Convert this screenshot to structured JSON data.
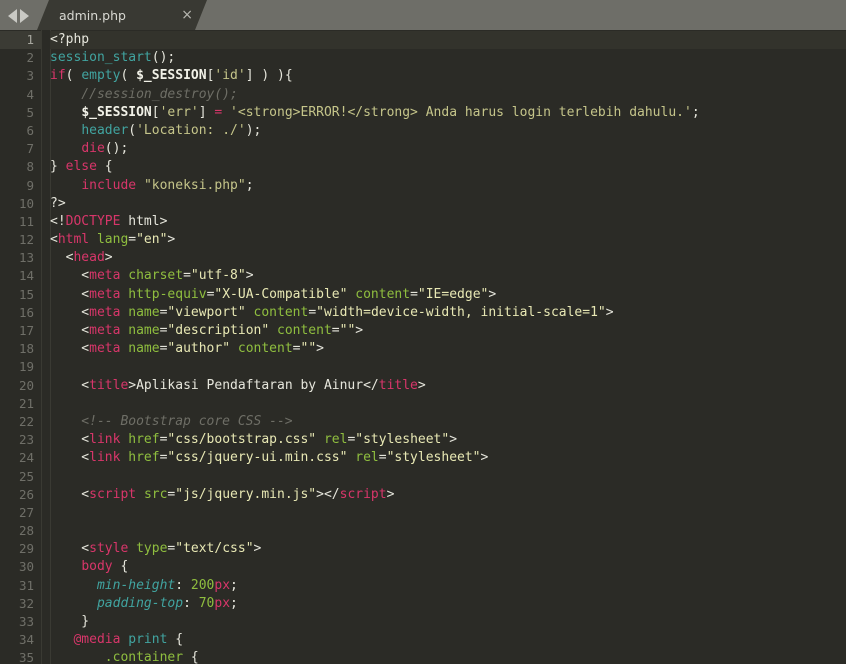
{
  "window": {
    "tab_bar": {
      "nav_prev_icon": "arrow-left-icon",
      "nav_next_icon": "arrow-right-icon",
      "tabs": [
        {
          "title": "admin.php",
          "close_label": "×",
          "active": true
        }
      ]
    }
  },
  "editor": {
    "language": "php",
    "current_line": 1,
    "first_line_number": 1,
    "line_count": 35,
    "lines": [
      {
        "n": 1,
        "tokens": [
          {
            "t": "<?php",
            "c": "t-plain"
          }
        ]
      },
      {
        "n": 2,
        "tokens": [
          {
            "t": "session_start",
            "c": "t-fn"
          },
          {
            "t": "();",
            "c": "t-punc"
          }
        ]
      },
      {
        "n": 3,
        "tokens": [
          {
            "t": "if",
            "c": "t-kw"
          },
          {
            "t": "( ",
            "c": "t-punc"
          },
          {
            "t": "empty",
            "c": "t-fn"
          },
          {
            "t": "( ",
            "c": "t-punc"
          },
          {
            "t": "$_SESSION",
            "c": "t-var"
          },
          {
            "t": "[",
            "c": "t-punc"
          },
          {
            "t": "'id'",
            "c": "t-str"
          },
          {
            "t": "] ) ){",
            "c": "t-punc"
          }
        ]
      },
      {
        "n": 4,
        "tokens": [
          {
            "t": "    //session_destroy();",
            "c": "t-com"
          }
        ]
      },
      {
        "n": 5,
        "tokens": [
          {
            "t": "    ",
            "c": "t-plain"
          },
          {
            "t": "$_SESSION",
            "c": "t-var"
          },
          {
            "t": "[",
            "c": "t-punc"
          },
          {
            "t": "'err'",
            "c": "t-str"
          },
          {
            "t": "] ",
            "c": "t-punc"
          },
          {
            "t": "=",
            "c": "t-op"
          },
          {
            "t": " ",
            "c": "t-plain"
          },
          {
            "t": "'<strong>ERROR!</strong> Anda harus login terlebih dahulu.'",
            "c": "t-str"
          },
          {
            "t": ";",
            "c": "t-punc"
          }
        ]
      },
      {
        "n": 6,
        "tokens": [
          {
            "t": "    ",
            "c": "t-plain"
          },
          {
            "t": "header",
            "c": "t-fn"
          },
          {
            "t": "(",
            "c": "t-punc"
          },
          {
            "t": "'Location: ./'",
            "c": "t-str"
          },
          {
            "t": ");",
            "c": "t-punc"
          }
        ]
      },
      {
        "n": 7,
        "tokens": [
          {
            "t": "    ",
            "c": "t-plain"
          },
          {
            "t": "die",
            "c": "t-kw"
          },
          {
            "t": "();",
            "c": "t-punc"
          }
        ]
      },
      {
        "n": 8,
        "tokens": [
          {
            "t": "} ",
            "c": "t-punc"
          },
          {
            "t": "else",
            "c": "t-kw"
          },
          {
            "t": " {",
            "c": "t-punc"
          }
        ]
      },
      {
        "n": 9,
        "tokens": [
          {
            "t": "    ",
            "c": "t-plain"
          },
          {
            "t": "include",
            "c": "t-kw"
          },
          {
            "t": " ",
            "c": "t-plain"
          },
          {
            "t": "\"koneksi.php\"",
            "c": "t-str"
          },
          {
            "t": ";",
            "c": "t-punc"
          }
        ]
      },
      {
        "n": 10,
        "tokens": [
          {
            "t": "?>",
            "c": "t-plain"
          }
        ]
      },
      {
        "n": 11,
        "tokens": [
          {
            "t": "<!",
            "c": "t-plain"
          },
          {
            "t": "DOCTYPE",
            "c": "t-doctype"
          },
          {
            "t": " html>",
            "c": "t-plain"
          }
        ]
      },
      {
        "n": 12,
        "tokens": [
          {
            "t": "<",
            "c": "t-bracket"
          },
          {
            "t": "html",
            "c": "t-tag"
          },
          {
            "t": " ",
            "c": "t-plain"
          },
          {
            "t": "lang",
            "c": "t-attr"
          },
          {
            "t": "=",
            "c": "t-plain"
          },
          {
            "t": "\"en\"",
            "c": "t-val"
          },
          {
            "t": ">",
            "c": "t-bracket"
          }
        ]
      },
      {
        "n": 13,
        "tokens": [
          {
            "t": "  <",
            "c": "t-bracket"
          },
          {
            "t": "head",
            "c": "t-tag"
          },
          {
            "t": ">",
            "c": "t-bracket"
          }
        ]
      },
      {
        "n": 14,
        "tokens": [
          {
            "t": "    <",
            "c": "t-bracket"
          },
          {
            "t": "meta",
            "c": "t-tag"
          },
          {
            "t": " ",
            "c": "t-plain"
          },
          {
            "t": "charset",
            "c": "t-attr"
          },
          {
            "t": "=",
            "c": "t-plain"
          },
          {
            "t": "\"utf-8\"",
            "c": "t-val"
          },
          {
            "t": ">",
            "c": "t-bracket"
          }
        ]
      },
      {
        "n": 15,
        "tokens": [
          {
            "t": "    <",
            "c": "t-bracket"
          },
          {
            "t": "meta",
            "c": "t-tag"
          },
          {
            "t": " ",
            "c": "t-plain"
          },
          {
            "t": "http-equiv",
            "c": "t-attr"
          },
          {
            "t": "=",
            "c": "t-plain"
          },
          {
            "t": "\"X-UA-Compatible\"",
            "c": "t-val"
          },
          {
            "t": " ",
            "c": "t-plain"
          },
          {
            "t": "content",
            "c": "t-attr"
          },
          {
            "t": "=",
            "c": "t-plain"
          },
          {
            "t": "\"IE=edge\"",
            "c": "t-val"
          },
          {
            "t": ">",
            "c": "t-bracket"
          }
        ]
      },
      {
        "n": 16,
        "tokens": [
          {
            "t": "    <",
            "c": "t-bracket"
          },
          {
            "t": "meta",
            "c": "t-tag"
          },
          {
            "t": " ",
            "c": "t-plain"
          },
          {
            "t": "name",
            "c": "t-attr"
          },
          {
            "t": "=",
            "c": "t-plain"
          },
          {
            "t": "\"viewport\"",
            "c": "t-val"
          },
          {
            "t": " ",
            "c": "t-plain"
          },
          {
            "t": "content",
            "c": "t-attr"
          },
          {
            "t": "=",
            "c": "t-plain"
          },
          {
            "t": "\"width=device-width, initial-scale=1\"",
            "c": "t-val"
          },
          {
            "t": ">",
            "c": "t-bracket"
          }
        ]
      },
      {
        "n": 17,
        "tokens": [
          {
            "t": "    <",
            "c": "t-bracket"
          },
          {
            "t": "meta",
            "c": "t-tag"
          },
          {
            "t": " ",
            "c": "t-plain"
          },
          {
            "t": "name",
            "c": "t-attr"
          },
          {
            "t": "=",
            "c": "t-plain"
          },
          {
            "t": "\"description\"",
            "c": "t-val"
          },
          {
            "t": " ",
            "c": "t-plain"
          },
          {
            "t": "content",
            "c": "t-attr"
          },
          {
            "t": "=",
            "c": "t-plain"
          },
          {
            "t": "\"\"",
            "c": "t-val"
          },
          {
            "t": ">",
            "c": "t-bracket"
          }
        ]
      },
      {
        "n": 18,
        "tokens": [
          {
            "t": "    <",
            "c": "t-bracket"
          },
          {
            "t": "meta",
            "c": "t-tag"
          },
          {
            "t": " ",
            "c": "t-plain"
          },
          {
            "t": "name",
            "c": "t-attr"
          },
          {
            "t": "=",
            "c": "t-plain"
          },
          {
            "t": "\"author\"",
            "c": "t-val"
          },
          {
            "t": " ",
            "c": "t-plain"
          },
          {
            "t": "content",
            "c": "t-attr"
          },
          {
            "t": "=",
            "c": "t-plain"
          },
          {
            "t": "\"\"",
            "c": "t-val"
          },
          {
            "t": ">",
            "c": "t-bracket"
          }
        ]
      },
      {
        "n": 19,
        "tokens": []
      },
      {
        "n": 20,
        "tokens": [
          {
            "t": "    <",
            "c": "t-bracket"
          },
          {
            "t": "title",
            "c": "t-tag"
          },
          {
            "t": ">",
            "c": "t-bracket"
          },
          {
            "t": "Aplikasi Pendaftaran by Ainur",
            "c": "t-strhtml"
          },
          {
            "t": "</",
            "c": "t-bracket"
          },
          {
            "t": "title",
            "c": "t-tag"
          },
          {
            "t": ">",
            "c": "t-bracket"
          }
        ]
      },
      {
        "n": 21,
        "tokens": []
      },
      {
        "n": 22,
        "tokens": [
          {
            "t": "    <!-- Bootstrap core CSS -->",
            "c": "t-com"
          }
        ]
      },
      {
        "n": 23,
        "tokens": [
          {
            "t": "    <",
            "c": "t-bracket"
          },
          {
            "t": "link",
            "c": "t-tag"
          },
          {
            "t": " ",
            "c": "t-plain"
          },
          {
            "t": "href",
            "c": "t-attr"
          },
          {
            "t": "=",
            "c": "t-plain"
          },
          {
            "t": "\"css/bootstrap.css\"",
            "c": "t-val"
          },
          {
            "t": " ",
            "c": "t-plain"
          },
          {
            "t": "rel",
            "c": "t-attr"
          },
          {
            "t": "=",
            "c": "t-plain"
          },
          {
            "t": "\"stylesheet\"",
            "c": "t-val"
          },
          {
            "t": ">",
            "c": "t-bracket"
          }
        ]
      },
      {
        "n": 24,
        "tokens": [
          {
            "t": "    <",
            "c": "t-bracket"
          },
          {
            "t": "link",
            "c": "t-tag"
          },
          {
            "t": " ",
            "c": "t-plain"
          },
          {
            "t": "href",
            "c": "t-attr"
          },
          {
            "t": "=",
            "c": "t-plain"
          },
          {
            "t": "\"css/jquery-ui.min.css\"",
            "c": "t-val"
          },
          {
            "t": " ",
            "c": "t-plain"
          },
          {
            "t": "rel",
            "c": "t-attr"
          },
          {
            "t": "=",
            "c": "t-plain"
          },
          {
            "t": "\"stylesheet\"",
            "c": "t-val"
          },
          {
            "t": ">",
            "c": "t-bracket"
          }
        ]
      },
      {
        "n": 25,
        "tokens": []
      },
      {
        "n": 26,
        "tokens": [
          {
            "t": "    <",
            "c": "t-bracket"
          },
          {
            "t": "script",
            "c": "t-tag"
          },
          {
            "t": " ",
            "c": "t-plain"
          },
          {
            "t": "src",
            "c": "t-attr"
          },
          {
            "t": "=",
            "c": "t-plain"
          },
          {
            "t": "\"js/jquery.min.js\"",
            "c": "t-val"
          },
          {
            "t": ">",
            "c": "t-bracket"
          },
          {
            "t": "</",
            "c": "t-bracket"
          },
          {
            "t": "script",
            "c": "t-tag"
          },
          {
            "t": ">",
            "c": "t-bracket"
          }
        ]
      },
      {
        "n": 27,
        "tokens": []
      },
      {
        "n": 28,
        "tokens": []
      },
      {
        "n": 29,
        "tokens": [
          {
            "t": "    <",
            "c": "t-bracket"
          },
          {
            "t": "style",
            "c": "t-tag"
          },
          {
            "t": " ",
            "c": "t-plain"
          },
          {
            "t": "type",
            "c": "t-attr"
          },
          {
            "t": "=",
            "c": "t-plain"
          },
          {
            "t": "\"text/css\"",
            "c": "t-val"
          },
          {
            "t": ">",
            "c": "t-bracket"
          }
        ]
      },
      {
        "n": 30,
        "tokens": [
          {
            "t": "    ",
            "c": "t-plain"
          },
          {
            "t": "body",
            "c": "t-css-sel"
          },
          {
            "t": " {",
            "c": "t-punc"
          }
        ]
      },
      {
        "n": 31,
        "tokens": [
          {
            "t": "      ",
            "c": "t-plain"
          },
          {
            "t": "min-height",
            "c": "t-css-prop"
          },
          {
            "t": ": ",
            "c": "t-punc"
          },
          {
            "t": "200",
            "c": "t-num"
          },
          {
            "t": "px",
            "c": "t-unit"
          },
          {
            "t": ";",
            "c": "t-punc"
          }
        ]
      },
      {
        "n": 32,
        "tokens": [
          {
            "t": "      ",
            "c": "t-plain"
          },
          {
            "t": "padding-top",
            "c": "t-css-prop"
          },
          {
            "t": ": ",
            "c": "t-punc"
          },
          {
            "t": "70",
            "c": "t-num"
          },
          {
            "t": "px",
            "c": "t-unit"
          },
          {
            "t": ";",
            "c": "t-punc"
          }
        ]
      },
      {
        "n": 33,
        "tokens": [
          {
            "t": "    }",
            "c": "t-punc"
          }
        ]
      },
      {
        "n": 34,
        "tokens": [
          {
            "t": "   ",
            "c": "t-plain"
          },
          {
            "t": "@media",
            "c": "t-at"
          },
          {
            "t": " ",
            "c": "t-plain"
          },
          {
            "t": "print",
            "c": "t-media"
          },
          {
            "t": " {",
            "c": "t-punc"
          }
        ]
      },
      {
        "n": 35,
        "tokens": [
          {
            "t": "       ",
            "c": "t-plain"
          },
          {
            "t": ".container",
            "c": "t-css-cls"
          },
          {
            "t": " {",
            "c": "t-punc"
          }
        ]
      }
    ]
  }
}
